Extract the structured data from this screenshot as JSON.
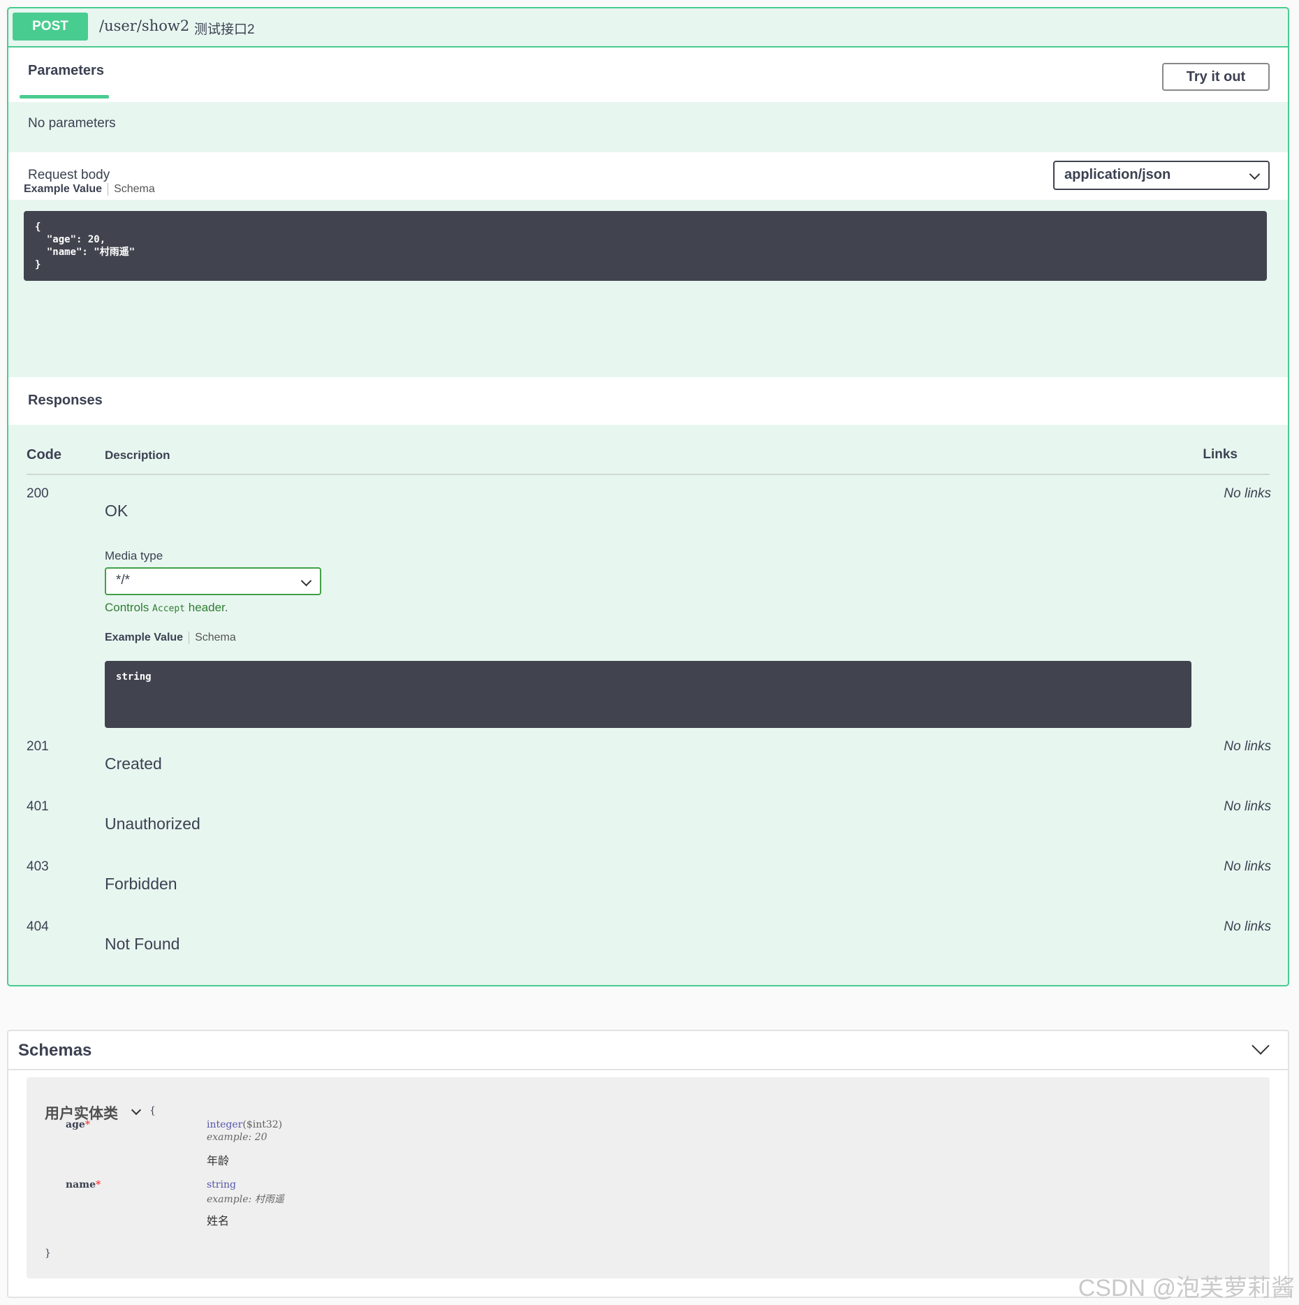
{
  "operation": {
    "method": "POST",
    "path": "/user/show2",
    "summary": "测试接口2",
    "parameters": {
      "tab_label": "Parameters",
      "try_it_out_label": "Try it out",
      "empty_text": "No parameters"
    },
    "request_body": {
      "label": "Request body",
      "content_type": "application/json",
      "example_tab": "Example Value",
      "schema_tab": "Schema",
      "example_code": "{\n  \"age\": 20,\n  \"name\": \"村雨遥\"\n}"
    },
    "responses": {
      "title": "Responses",
      "columns": {
        "code": "Code",
        "description": "Description",
        "links": "Links"
      },
      "media_type_label": "Media type",
      "media_type_value": "*/*",
      "controls_prefix": "Controls",
      "controls_code": "Accept",
      "controls_suffix": "header.",
      "example_tab": "Example Value",
      "schema_tab": "Schema",
      "example_code": "string",
      "rows": [
        {
          "code": "200",
          "description": "OK",
          "links": "No links"
        },
        {
          "code": "201",
          "description": "Created",
          "links": "No links"
        },
        {
          "code": "401",
          "description": "Unauthorized",
          "links": "No links"
        },
        {
          "code": "403",
          "description": "Forbidden",
          "links": "No links"
        },
        {
          "code": "404",
          "description": "Not Found",
          "links": "No links"
        }
      ]
    }
  },
  "schemas": {
    "title": "Schemas",
    "model": {
      "name": "用户实体类",
      "open_brace": "{",
      "close_brace": "}",
      "properties": [
        {
          "name": "age",
          "required_mark": "*",
          "type": "integer",
          "format": "($int32)",
          "example_label": "example:",
          "example": "20",
          "description": "年龄"
        },
        {
          "name": "name",
          "required_mark": "*",
          "type": "string",
          "format": "",
          "example_label": "example:",
          "example": "村雨遥",
          "description": "姓名"
        }
      ]
    }
  },
  "watermark": "CSDN @泡芙萝莉酱",
  "colors": {
    "post_green": "#49cc90",
    "op_bg": "#e8f6f0",
    "code_bg": "#41444e"
  }
}
